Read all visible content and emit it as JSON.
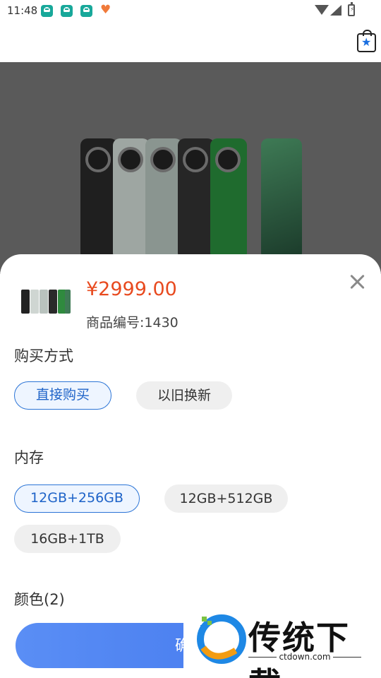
{
  "status_bar": {
    "time": "11:48",
    "notification_icons": [
      "app-notification-icon",
      "app-notification-icon",
      "app-notification-icon",
      "heart-icon"
    ],
    "right_icons": [
      "wifi-icon",
      "signal-icon",
      "battery-icon"
    ]
  },
  "header": {
    "icon": "shopping-bag-icon"
  },
  "product": {
    "price": "¥2999.00",
    "sku_label": "商品编号:1430"
  },
  "purchase_method": {
    "title": "购买方式",
    "options": [
      "直接购买",
      "以旧换新"
    ],
    "selected": "直接购买"
  },
  "storage": {
    "title": "内存",
    "options": [
      "12GB+256GB",
      "12GB+512GB",
      "16GB+1TB"
    ],
    "selected": "12GB+256GB"
  },
  "color": {
    "title": "颜色(2)"
  },
  "footer": {
    "confirm_label": "确"
  },
  "watermark": {
    "name": "传统下载",
    "url": "ctdown.com"
  },
  "colors": {
    "accent": "#2b74d6",
    "price": "#e84a1f",
    "button": "#4a80f0"
  }
}
